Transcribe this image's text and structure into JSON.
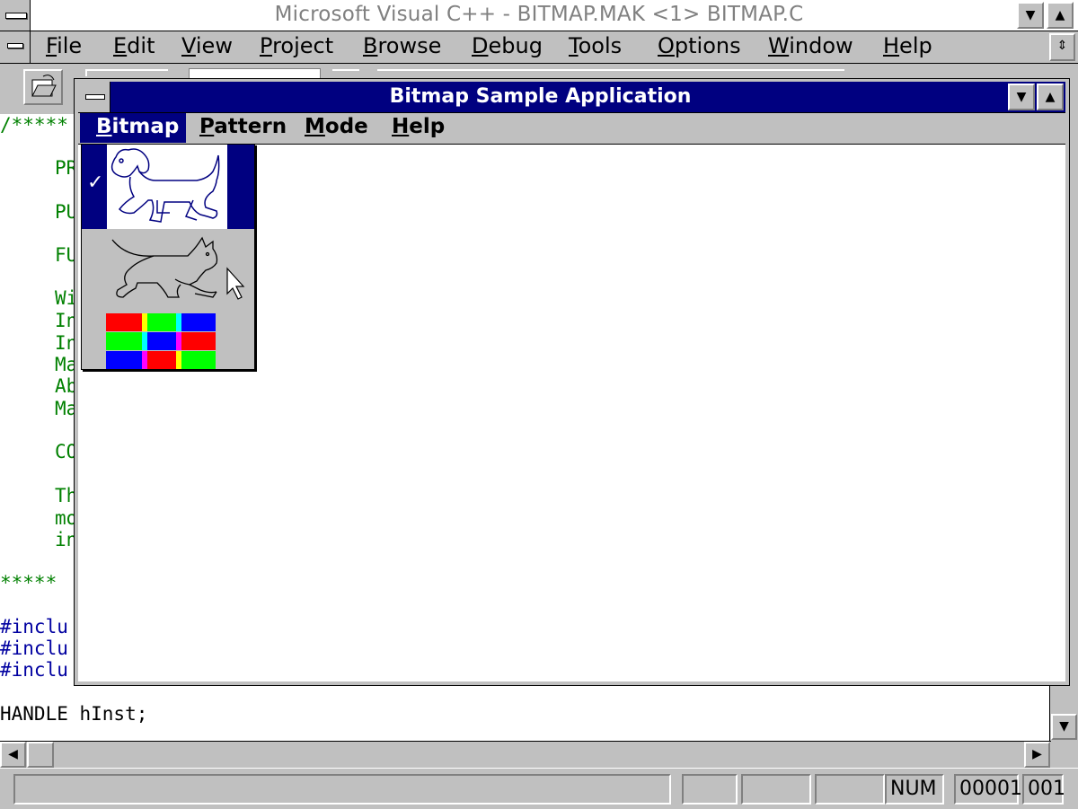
{
  "app": {
    "title": "Microsoft Visual C++ - BITMAP.MAK <1> BITMAP.C",
    "menu": [
      {
        "label": "File",
        "ul": "F",
        "rest": "ile"
      },
      {
        "label": "Edit",
        "ul": "E",
        "rest": "dit"
      },
      {
        "label": "View",
        "ul": "V",
        "rest": "iew"
      },
      {
        "label": "Project",
        "ul": "P",
        "rest": "roject"
      },
      {
        "label": "Browse",
        "ul": "B",
        "rest": "rowse"
      },
      {
        "label": "Debug",
        "ul": "D",
        "rest": "ebug"
      },
      {
        "label": "Tools",
        "ul": "T",
        "rest": "ools"
      },
      {
        "label": "Options",
        "ul": "O",
        "rest": "ptions"
      },
      {
        "label": "Window",
        "ul": "W",
        "rest": "indow"
      },
      {
        "label": "Help",
        "ul": "H",
        "rest": "elp"
      }
    ]
  },
  "editor": {
    "lines": {
      "l1": "/*****",
      "l2": "PR",
      "l3": "PU",
      "l4": "FU",
      "l5": "Wi",
      "l6": "In",
      "l7": "In",
      "l8": "Ma",
      "l9": "Ab",
      "l10": "Ma",
      "l11": "CO",
      "l12": "Th",
      "l13": "mo",
      "l14": "in",
      "l15": "*****",
      "l16": "#inclu",
      "l17": "#inclu",
      "l18": "#inclu",
      "l19": "HANDLE hInst;"
    }
  },
  "child": {
    "title": "Bitmap Sample Application",
    "menu": [
      {
        "ul": "B",
        "rest": "itmap"
      },
      {
        "ul": "P",
        "rest": "attern"
      },
      {
        "ul": "M",
        "rest": "ode"
      },
      {
        "ul": "H",
        "rest": "elp"
      }
    ],
    "dropdown": {
      "checkmark": "✓",
      "items": [
        "dog-bitmap",
        "cat-bitmap",
        "color-blocks-bitmap"
      ],
      "checked_index": 0
    }
  },
  "status": {
    "num": "NUM",
    "line": "00001",
    "col": "001"
  },
  "colors": {
    "title_active": "#000080",
    "face": "#c0c0c0",
    "code_green": "#008000",
    "code_blue": "#0000a0"
  }
}
